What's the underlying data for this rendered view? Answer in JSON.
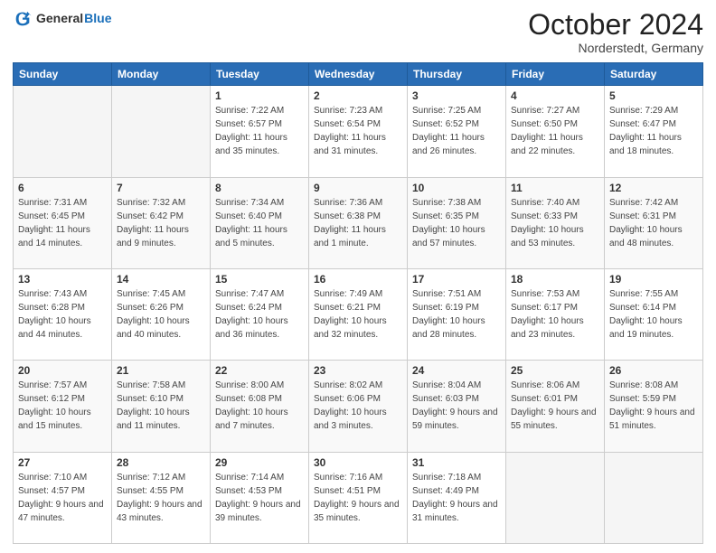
{
  "header": {
    "logo": {
      "text_general": "General",
      "text_blue": "Blue"
    },
    "title": "October 2024",
    "location": "Norderstedt, Germany"
  },
  "weekdays": [
    "Sunday",
    "Monday",
    "Tuesday",
    "Wednesday",
    "Thursday",
    "Friday",
    "Saturday"
  ],
  "weeks": [
    [
      {
        "day": "",
        "empty": true
      },
      {
        "day": "",
        "empty": true
      },
      {
        "day": "1",
        "sunrise": "7:22 AM",
        "sunset": "6:57 PM",
        "daylight": "11 hours and 35 minutes."
      },
      {
        "day": "2",
        "sunrise": "7:23 AM",
        "sunset": "6:54 PM",
        "daylight": "11 hours and 31 minutes."
      },
      {
        "day": "3",
        "sunrise": "7:25 AM",
        "sunset": "6:52 PM",
        "daylight": "11 hours and 26 minutes."
      },
      {
        "day": "4",
        "sunrise": "7:27 AM",
        "sunset": "6:50 PM",
        "daylight": "11 hours and 22 minutes."
      },
      {
        "day": "5",
        "sunrise": "7:29 AM",
        "sunset": "6:47 PM",
        "daylight": "11 hours and 18 minutes."
      }
    ],
    [
      {
        "day": "6",
        "sunrise": "7:31 AM",
        "sunset": "6:45 PM",
        "daylight": "11 hours and 14 minutes."
      },
      {
        "day": "7",
        "sunrise": "7:32 AM",
        "sunset": "6:42 PM",
        "daylight": "11 hours and 9 minutes."
      },
      {
        "day": "8",
        "sunrise": "7:34 AM",
        "sunset": "6:40 PM",
        "daylight": "11 hours and 5 minutes."
      },
      {
        "day": "9",
        "sunrise": "7:36 AM",
        "sunset": "6:38 PM",
        "daylight": "11 hours and 1 minute."
      },
      {
        "day": "10",
        "sunrise": "7:38 AM",
        "sunset": "6:35 PM",
        "daylight": "10 hours and 57 minutes."
      },
      {
        "day": "11",
        "sunrise": "7:40 AM",
        "sunset": "6:33 PM",
        "daylight": "10 hours and 53 minutes."
      },
      {
        "day": "12",
        "sunrise": "7:42 AM",
        "sunset": "6:31 PM",
        "daylight": "10 hours and 48 minutes."
      }
    ],
    [
      {
        "day": "13",
        "sunrise": "7:43 AM",
        "sunset": "6:28 PM",
        "daylight": "10 hours and 44 minutes."
      },
      {
        "day": "14",
        "sunrise": "7:45 AM",
        "sunset": "6:26 PM",
        "daylight": "10 hours and 40 minutes."
      },
      {
        "day": "15",
        "sunrise": "7:47 AM",
        "sunset": "6:24 PM",
        "daylight": "10 hours and 36 minutes."
      },
      {
        "day": "16",
        "sunrise": "7:49 AM",
        "sunset": "6:21 PM",
        "daylight": "10 hours and 32 minutes."
      },
      {
        "day": "17",
        "sunrise": "7:51 AM",
        "sunset": "6:19 PM",
        "daylight": "10 hours and 28 minutes."
      },
      {
        "day": "18",
        "sunrise": "7:53 AM",
        "sunset": "6:17 PM",
        "daylight": "10 hours and 23 minutes."
      },
      {
        "day": "19",
        "sunrise": "7:55 AM",
        "sunset": "6:14 PM",
        "daylight": "10 hours and 19 minutes."
      }
    ],
    [
      {
        "day": "20",
        "sunrise": "7:57 AM",
        "sunset": "6:12 PM",
        "daylight": "10 hours and 15 minutes."
      },
      {
        "day": "21",
        "sunrise": "7:58 AM",
        "sunset": "6:10 PM",
        "daylight": "10 hours and 11 minutes."
      },
      {
        "day": "22",
        "sunrise": "8:00 AM",
        "sunset": "6:08 PM",
        "daylight": "10 hours and 7 minutes."
      },
      {
        "day": "23",
        "sunrise": "8:02 AM",
        "sunset": "6:06 PM",
        "daylight": "10 hours and 3 minutes."
      },
      {
        "day": "24",
        "sunrise": "8:04 AM",
        "sunset": "6:03 PM",
        "daylight": "9 hours and 59 minutes."
      },
      {
        "day": "25",
        "sunrise": "8:06 AM",
        "sunset": "6:01 PM",
        "daylight": "9 hours and 55 minutes."
      },
      {
        "day": "26",
        "sunrise": "8:08 AM",
        "sunset": "5:59 PM",
        "daylight": "9 hours and 51 minutes."
      }
    ],
    [
      {
        "day": "27",
        "sunrise": "7:10 AM",
        "sunset": "4:57 PM",
        "daylight": "9 hours and 47 minutes."
      },
      {
        "day": "28",
        "sunrise": "7:12 AM",
        "sunset": "4:55 PM",
        "daylight": "9 hours and 43 minutes."
      },
      {
        "day": "29",
        "sunrise": "7:14 AM",
        "sunset": "4:53 PM",
        "daylight": "9 hours and 39 minutes."
      },
      {
        "day": "30",
        "sunrise": "7:16 AM",
        "sunset": "4:51 PM",
        "daylight": "9 hours and 35 minutes."
      },
      {
        "day": "31",
        "sunrise": "7:18 AM",
        "sunset": "4:49 PM",
        "daylight": "9 hours and 31 minutes."
      },
      {
        "day": "",
        "empty": true
      },
      {
        "day": "",
        "empty": true
      }
    ]
  ]
}
